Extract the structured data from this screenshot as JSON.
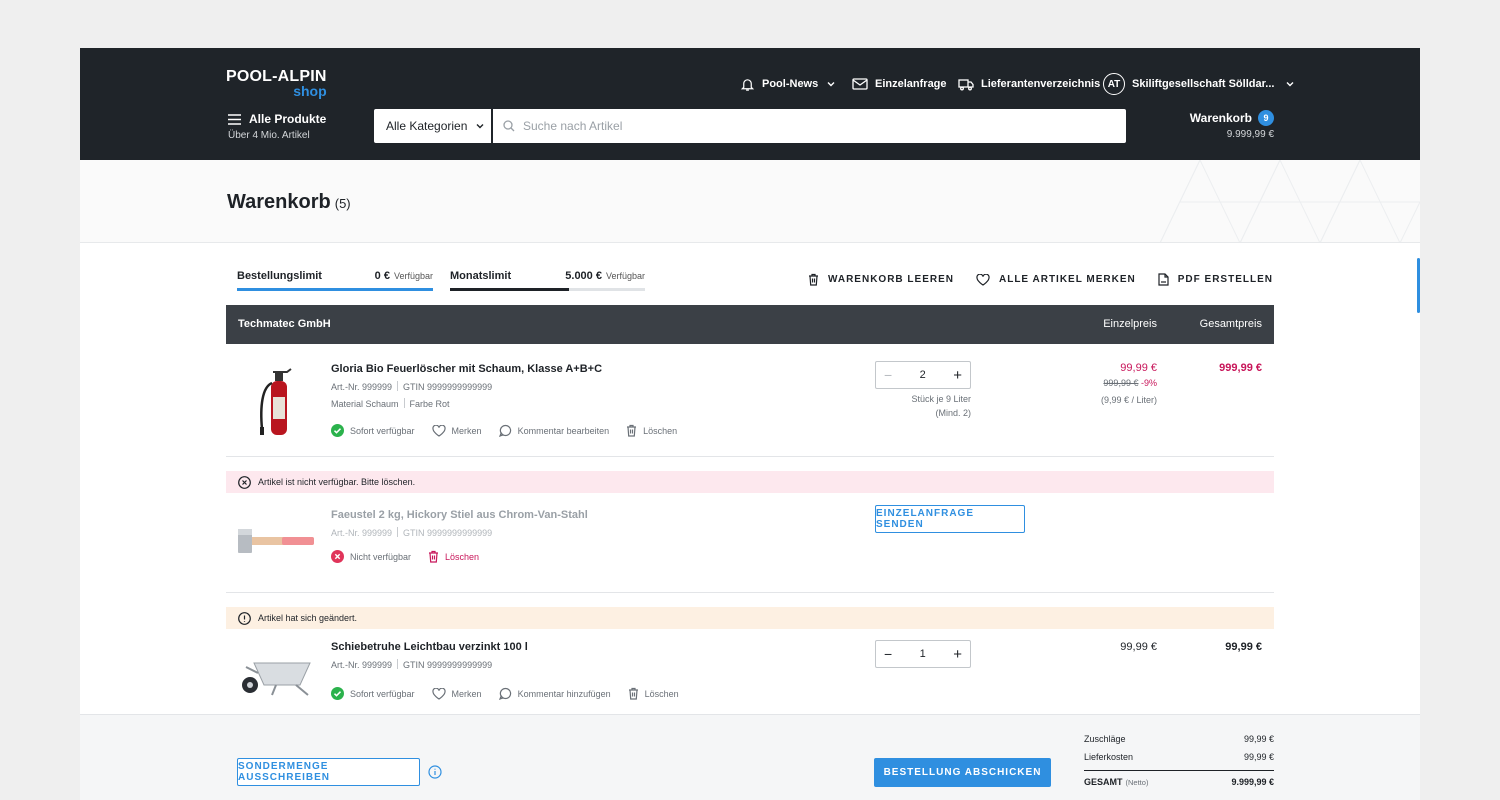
{
  "header": {
    "logo_top": "POOL-ALPIN",
    "logo_bottom": "shop",
    "nav": {
      "news": "Pool-News",
      "inquiry": "Einzelanfrage",
      "suppliers": "Lieferantenverzeichnis",
      "account_initials": "AT",
      "account_name": "Skiliftgesellschaft Sölldar..."
    },
    "all_products": "Alle Produkte",
    "all_products_sub": "Über 4 Mio. Artikel",
    "category": "Alle Kategorien",
    "search_placeholder": "Suche nach Artikel",
    "cart_label": "Warenkorb",
    "cart_count": "9",
    "cart_total": "9.999,99 €"
  },
  "page": {
    "title": "Warenkorb",
    "count": "(5)"
  },
  "limits": {
    "order_limit": {
      "label": "Bestellungslimit",
      "value": "0 €",
      "suffix": "Verfügbar",
      "fill": 1.0,
      "color": "#2f8fe0"
    },
    "month_limit": {
      "label": "Monatslimit",
      "value": "5.000 €",
      "suffix": "Verfügbar",
      "fill": 0.61,
      "color": "#1e2227"
    }
  },
  "actions": {
    "clear": "WARENKORB LEEREN",
    "remember_all": "ALLE ARTIKEL MERKEN",
    "pdf": "PDF ERSTELLEN"
  },
  "table": {
    "vendor": "Techmatec GmbH",
    "col_unit": "Einzelpreis",
    "col_total": "Gesamtpreis"
  },
  "items": [
    {
      "name": "Gloria Bio Feuerlöscher mit Schaum, Klasse A+B+C",
      "art": "Art.-Nr. 999999",
      "gtin": "GTIN 9999999999999",
      "material": "Material Schaum",
      "color": "Farbe Rot",
      "availability": "Sofort verfügbar",
      "remember": "Merken",
      "comment": "Kommentar bearbeiten",
      "delete": "Löschen",
      "qty": "2",
      "qty_note1": "Stück je 9 Liter",
      "qty_note2": "(Mind. 2)",
      "unit_price": "99,99 €",
      "old_price": "999,99 €",
      "discount": "-9%",
      "per_unit": "(9,99 € / Liter)",
      "total": "999,99 €"
    },
    {
      "notice": "Artikel ist nicht verfügbar. Bitte löschen.",
      "name": "Faeustel 2 kg, Hickory Stiel aus Chrom-Van-Stahl",
      "art": "Art.-Nr. 999999",
      "gtin": "GTIN 9999999999999",
      "availability": "Nicht verfügbar",
      "delete": "Löschen",
      "inquiry_button": "EINZELANFRAGE SENDEN"
    },
    {
      "notice": "Artikel hat sich geändert.",
      "name": "Schiebetruhe Leichtbau verzinkt 100 l",
      "art": "Art.-Nr. 999999",
      "gtin": "GTIN 9999999999999",
      "availability": "Sofort verfügbar",
      "remember": "Merken",
      "comment": "Kommentar hinzufügen",
      "delete": "Löschen",
      "qty": "1",
      "unit_price": "99,99 €",
      "total": "99,99 €"
    }
  ],
  "footer": {
    "special_button": "SONDERMENGE AUSSCHREIBEN",
    "order_button": "BESTELLUNG ABSCHICKEN",
    "surcharges_label": "Zuschläge",
    "surcharges_value": "99,99 €",
    "delivery_label": "Lieferkosten",
    "delivery_value": "99,99 €",
    "total_label": "GESAMT",
    "total_suffix": "(Netto)",
    "total_value": "9.999,99 €"
  },
  "colors": {
    "header_bg": "#1f2429",
    "accent": "#2f8fe0",
    "price_red": "#c8165a",
    "error_bg": "#fde8ee",
    "warning_bg": "#fdf0e2",
    "success": "#2bb24c"
  }
}
